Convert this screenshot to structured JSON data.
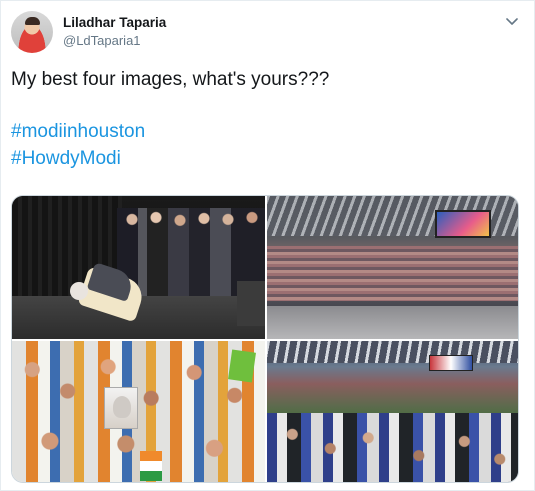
{
  "tweet": {
    "display_name": "Liladhar Taparia",
    "handle": "@LdTaparia1",
    "text": "My best four images, what's yours???",
    "hashtags": [
      "#modiinhouston",
      "#HowdyModi"
    ],
    "menu_icon": "chevron-down-icon"
  },
  "media": {
    "count": 4,
    "items": [
      {
        "icon": "photo"
      },
      {
        "icon": "photo"
      },
      {
        "icon": "photo"
      },
      {
        "icon": "photo"
      }
    ]
  },
  "colors": {
    "link": "#1b95e0",
    "text": "#14171a",
    "secondary": "#657786"
  }
}
